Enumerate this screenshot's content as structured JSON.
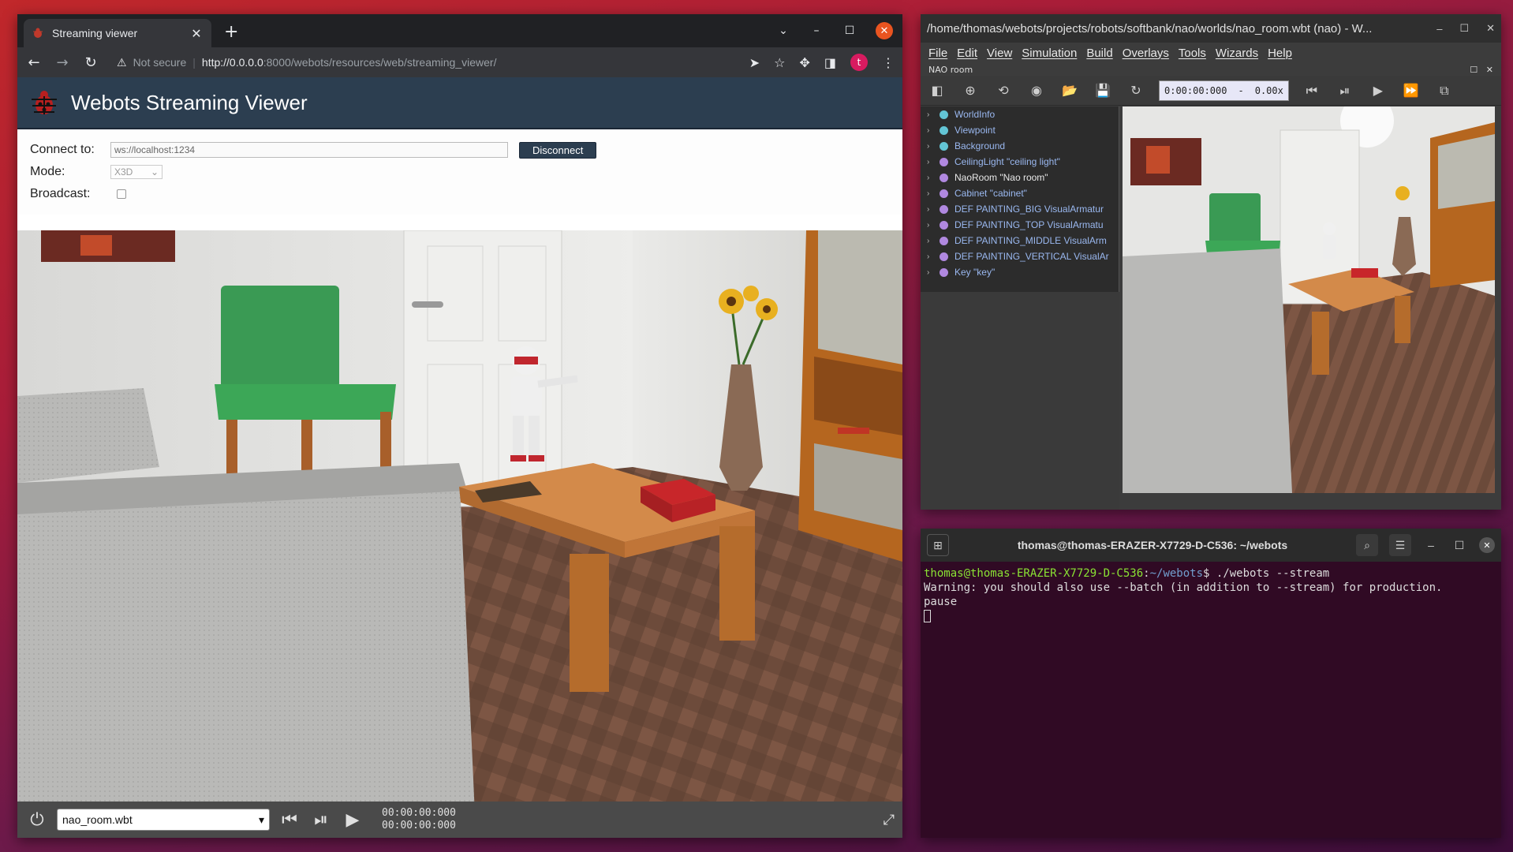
{
  "browser": {
    "tab_title": "Streaming viewer",
    "new_tab": "+",
    "security": "Not secure",
    "url_host": "http://0.0.0.0",
    "url_path": ":8000/webots/resources/web/streaming_viewer/",
    "avatar_letter": "t"
  },
  "viewer": {
    "title": "Webots Streaming Viewer",
    "connect_label": "Connect to:",
    "connect_value": "ws://localhost:1234",
    "disconnect_label": "Disconnect",
    "mode_label": "Mode:",
    "mode_value": "X3D",
    "broadcast_label": "Broadcast:",
    "world_select": "nao_room.wbt",
    "time_1": "00:00:00:000",
    "time_2": "00:00:00:000"
  },
  "webots": {
    "title": "/home/thomas/webots/projects/robots/softbank/nao/worlds/nao_room.wbt (nao) - W...",
    "menus": [
      "File",
      "Edit",
      "View",
      "Simulation",
      "Build",
      "Overlays",
      "Tools",
      "Wizards",
      "Help"
    ],
    "world_name": "NAO room",
    "sim_time": "0:00:00:000",
    "speed": "0.00x",
    "speed_sep": "-",
    "tree": [
      {
        "label": "WorldInfo",
        "color": "#63c5d5",
        "style": "blue"
      },
      {
        "label": "Viewpoint",
        "color": "#63c5d5",
        "style": "blue"
      },
      {
        "label": "Background",
        "color": "#63c5d5",
        "style": "blue"
      },
      {
        "label": "CeilingLight \"ceiling light\"",
        "color": "#b088e0",
        "style": "blue"
      },
      {
        "label": "NaoRoom \"Nao room\"",
        "color": "#b088e0",
        "style": "white"
      },
      {
        "label": "Cabinet \"cabinet\"",
        "color": "#b088e0",
        "style": "blue"
      },
      {
        "label": "DEF PAINTING_BIG VisualArmatur",
        "color": "#b088e0",
        "style": "blue"
      },
      {
        "label": "DEF PAINTING_TOP VisualArmatu",
        "color": "#b088e0",
        "style": "blue"
      },
      {
        "label": "DEF PAINTING_MIDDLE VisualArm",
        "color": "#b088e0",
        "style": "blue"
      },
      {
        "label": "DEF PAINTING_VERTICAL VisualAr",
        "color": "#b088e0",
        "style": "blue"
      },
      {
        "label": "Key \"key\"",
        "color": "#b088e0",
        "style": "blue"
      }
    ]
  },
  "terminal": {
    "title": "thomas@thomas-ERAZER-X7729-D-C536: ~/webots",
    "prompt_user": "thomas@thomas-ERAZER-X7729-D-C536",
    "prompt_sep": ":",
    "prompt_path": "~/webots",
    "command": "$ ./webots --stream",
    "line2": "Warning: you should also use --batch (in addition to --stream) for production.",
    "line3": "pause"
  }
}
